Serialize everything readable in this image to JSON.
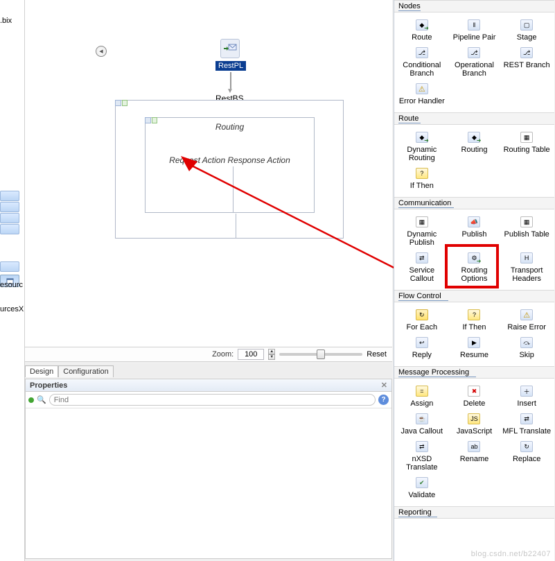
{
  "left_strip": {
    "file_ext": ".bix",
    "label_resources": "esourc",
    "label_resourcesX": "urcesX"
  },
  "canvas": {
    "pipeline_label": "RestPL",
    "bs_label": "RestBS",
    "container_title": "Routing",
    "actions_text": "Request Action Response Action"
  },
  "zoom": {
    "label": "Zoom:",
    "value": "100",
    "reset": "Reset"
  },
  "tabs": {
    "design": "Design",
    "configuration": "Configuration"
  },
  "properties": {
    "title": "Properties",
    "find_placeholder": "Find"
  },
  "palette": {
    "sections": {
      "nodes": "Nodes",
      "route": "Route",
      "communication": "Communication",
      "flow_control": "Flow Control",
      "message_processing": "Message Processing",
      "reporting": "Reporting"
    },
    "nodes": {
      "route": "Route",
      "pipeline_pair": "Pipeline Pair",
      "stage": "Stage",
      "conditional_branch": "Conditional Branch",
      "operational_branch": "Operational Branch",
      "rest_branch": "REST Branch",
      "error_handler": "Error Handler"
    },
    "route": {
      "dynamic_routing": "Dynamic Routing",
      "routing": "Routing",
      "routing_table": "Routing Table",
      "if_then": "If Then"
    },
    "communication": {
      "dynamic_publish": "Dynamic Publish",
      "publish": "Publish",
      "publish_table": "Publish Table",
      "service_callout": "Service Callout",
      "routing_options": "Routing Options",
      "transport_headers": "Transport Headers"
    },
    "flow_control": {
      "for_each": "For Each",
      "if_then": "If Then",
      "raise_error": "Raise Error",
      "reply": "Reply",
      "resume": "Resume",
      "skip": "Skip"
    },
    "message_processing": {
      "assign": "Assign",
      "delete": "Delete",
      "insert": "Insert",
      "java_callout": "Java Callout",
      "javascript": "JavaScript",
      "mfl_translate": "MFL Translate",
      "nxsd_translate": "nXSD Translate",
      "rename": "Rename",
      "replace": "Replace",
      "validate": "Validate"
    }
  },
  "watermark": "blog.csdn.net/b22407"
}
